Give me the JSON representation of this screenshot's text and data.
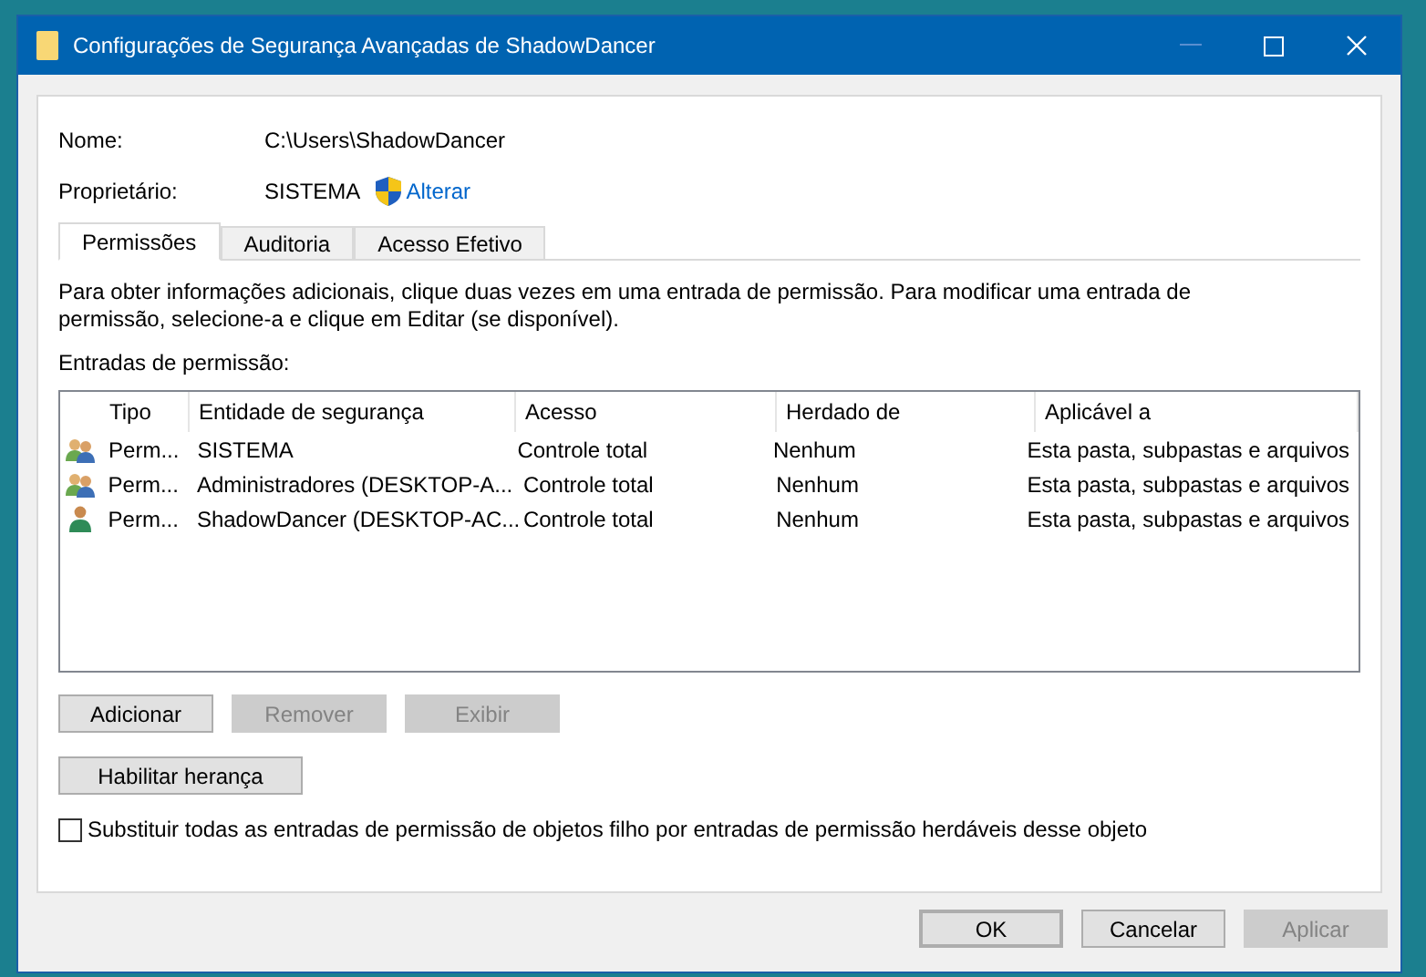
{
  "window": {
    "title": "Configurações de Segurança Avançadas de ShadowDancer"
  },
  "fields": [
    {
      "label": "Nome:",
      "value": "C:\\Users\\ShadowDancer"
    },
    {
      "label": "Proprietário:",
      "value": "SISTEMA",
      "link": "Alterar"
    }
  ],
  "tabs": [
    {
      "label": "Permissões",
      "selected": true
    },
    {
      "label": "Auditoria",
      "selected": false
    },
    {
      "label": "Acesso Efetivo",
      "selected": false
    }
  ],
  "description": "Para obter informações adicionais, clique duas vezes em uma entrada de permissão. Para modificar uma entrada de permissão, selecione-a e clique em Editar (se disponível).",
  "list_label": "Entradas de permissão:",
  "table": {
    "columns": [
      "Tipo",
      "Entidade de segurança",
      "Acesso",
      "Herdado de",
      "Aplicável a"
    ],
    "rows": [
      {
        "kind": "group",
        "cells": [
          "Perm...",
          "SISTEMA",
          "Controle total",
          "Nenhum",
          "Esta pasta, subpastas e arquivos"
        ]
      },
      {
        "kind": "group",
        "cells": [
          "Perm...",
          "Administradores (DESKTOP-A...",
          "Controle total",
          "Nenhum",
          "Esta pasta, subpastas e arquivos"
        ]
      },
      {
        "kind": "user",
        "cells": [
          "Perm...",
          "ShadowDancer (DESKTOP-AC...",
          "Controle total",
          "Nenhum",
          "Esta pasta, subpastas e arquivos"
        ]
      }
    ]
  },
  "entry_buttons": [
    {
      "label": "Adicionar",
      "disabled": false
    },
    {
      "label": "Remover",
      "disabled": true
    },
    {
      "label": "Exibir",
      "disabled": true
    }
  ],
  "inheritance_button": {
    "label": "Habilitar herança"
  },
  "replace_checkbox": {
    "label": "Substituir todas as entradas de permissão de objetos filho por entradas de permissão herdáveis desse objeto",
    "checked": false
  },
  "dialog_buttons": [
    {
      "label": "OK",
      "disabled": false,
      "default": true
    },
    {
      "label": "Cancelar",
      "disabled": false,
      "default": false
    },
    {
      "label": "Aplicar",
      "disabled": true,
      "default": false
    }
  ]
}
